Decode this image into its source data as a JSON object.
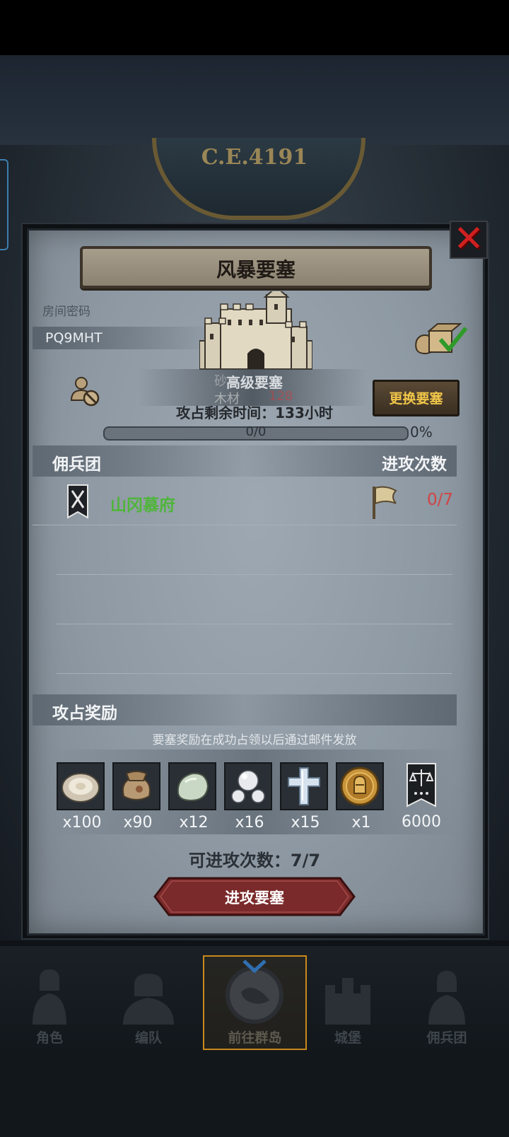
{
  "background": {
    "era_label": "C.E.4191"
  },
  "modal": {
    "title": "风暴要塞",
    "room_code_label": "房间密码",
    "room_code": "PQ9MHT",
    "fortress_name": "高级要塞",
    "overlap_text": {
      "line1": "砂",
      "line2": "木材",
      "value": "128"
    },
    "remaining_time": "攻占剩余时间：133小时",
    "change_button": "更换要塞",
    "progress": {
      "text": "0/0",
      "percent_label": "0%",
      "fraction": 0
    },
    "mercenary_header": "佣兵团",
    "attacks_header": "进攻次数",
    "mercenaries": [
      {
        "name": "山冈慕府",
        "attacks": "0/7"
      }
    ],
    "rewards_header": "攻占奖励",
    "rewards_note": "要塞奖励在成功占领以后通过邮件发放",
    "rewards": [
      {
        "icon": "oyster-icon",
        "qty": "x100"
      },
      {
        "icon": "sack-icon",
        "qty": "x90"
      },
      {
        "icon": "jade-stone-icon",
        "qty": "x12"
      },
      {
        "icon": "pearls-icon",
        "qty": "x16"
      },
      {
        "icon": "crystal-cross-icon",
        "qty": "x15"
      },
      {
        "icon": "knight-medal-icon",
        "qty": "x1"
      },
      {
        "icon": "justice-banner-icon",
        "qty": "6000"
      }
    ],
    "attack_count": "可进攻次数：7/7",
    "attack_button": "进攻要塞"
  },
  "bottom_nav": [
    {
      "label": "角色",
      "active": false
    },
    {
      "label": "编队",
      "active": false
    },
    {
      "label": "前往群岛",
      "active": true
    },
    {
      "label": "城堡",
      "active": false
    },
    {
      "label": "佣兵团",
      "active": false
    }
  ],
  "colors": {
    "accent_gold": "#f0c64a",
    "mercenary_green": "#4fb53a",
    "count_red": "#d04444",
    "close_red": "#d02020",
    "nav_active_border": "#c8891c"
  }
}
